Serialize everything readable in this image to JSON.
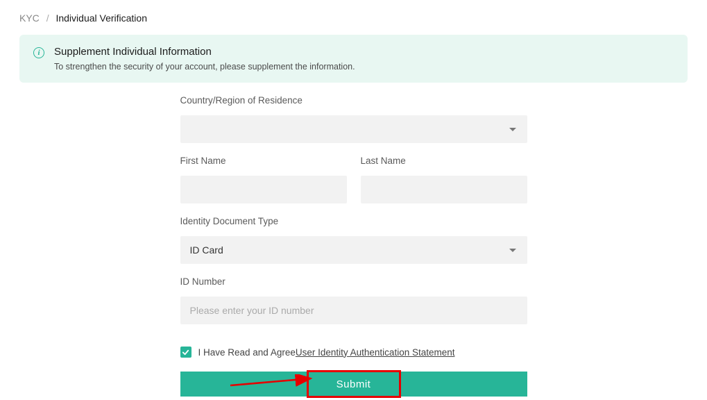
{
  "breadcrumb": {
    "parent": "KYC",
    "separator": "/",
    "current": "Individual Verification"
  },
  "banner": {
    "title": "Supplement Individual Information",
    "description": "To strengthen the security of your account, please supplement the information."
  },
  "form": {
    "country_label": "Country/Region of Residence",
    "country_value": "",
    "first_name_label": "First Name",
    "first_name_value": "",
    "last_name_label": "Last Name",
    "last_name_value": "",
    "doc_type_label": "Identity Document Type",
    "doc_type_value": "ID Card",
    "id_number_label": "ID Number",
    "id_number_placeholder": "Please enter your ID number",
    "id_number_value": "",
    "agree_text_prefix": "I Have Read and Agree",
    "agree_link_text": "User Identity Authentication Statement",
    "agree_checked": true,
    "submit_label": "Submit"
  }
}
